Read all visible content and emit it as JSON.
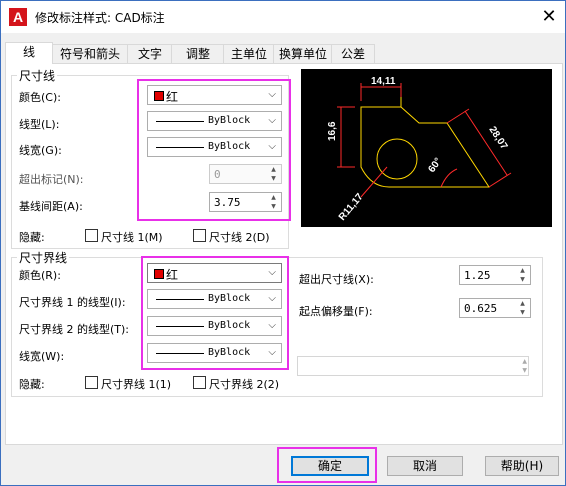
{
  "window": {
    "title": "修改标注样式: CAD标注",
    "icon_letter": "A",
    "close_glyph": "✕"
  },
  "tabs": [
    "线",
    "符号和箭头",
    "文字",
    "调整",
    "主单位",
    "换算单位",
    "公差"
  ],
  "dim_lines": {
    "title": "尺寸线",
    "color": {
      "label": "颜色(C):",
      "value": "红",
      "swatch": "#e00000"
    },
    "linetype": {
      "label": "线型(L):",
      "value": "ByBlock"
    },
    "lineweight": {
      "label": "线宽(G):",
      "value": "ByBlock"
    },
    "extend_ticks": {
      "label": "超出标记(N):",
      "value": "0"
    },
    "baseline_spacing": {
      "label": "基线间距(A):",
      "value": "3.75"
    },
    "suppress": {
      "label": "隐藏:",
      "line1": "尺寸线 1(M)",
      "line2": "尺寸线 2(D)"
    }
  },
  "ext_lines": {
    "title": "尺寸界线",
    "color": {
      "label": "颜色(R):",
      "value": "红"
    },
    "linetype1": {
      "label": "尺寸界线 1 的线型(I):",
      "value": "ByBlock"
    },
    "linetype2": {
      "label": "尺寸界线 2 的线型(T):",
      "value": "ByBlock"
    },
    "lineweight": {
      "label": "线宽(W):",
      "value": "ByBlock"
    },
    "suppress": {
      "label": "隐藏:",
      "line1": "尺寸界线 1(1)",
      "line2": "尺寸界线 2(2)"
    },
    "extend_beyond": {
      "label": "超出尺寸线(X):",
      "value": "1.25"
    },
    "offset": {
      "label": "起点偏移量(F):",
      "value": "0.625"
    }
  },
  "preview": {
    "dim_top": "14,11",
    "dim_left": "16,6",
    "dim_diag": "28,07",
    "dim_angle": "60°",
    "dim_radius": "R11,17"
  },
  "buttons": {
    "ok": "确定",
    "cancel": "取消",
    "help": "帮助(H)"
  },
  "colors": {
    "highlight": "#e830e8",
    "accent": "#0078d7"
  }
}
